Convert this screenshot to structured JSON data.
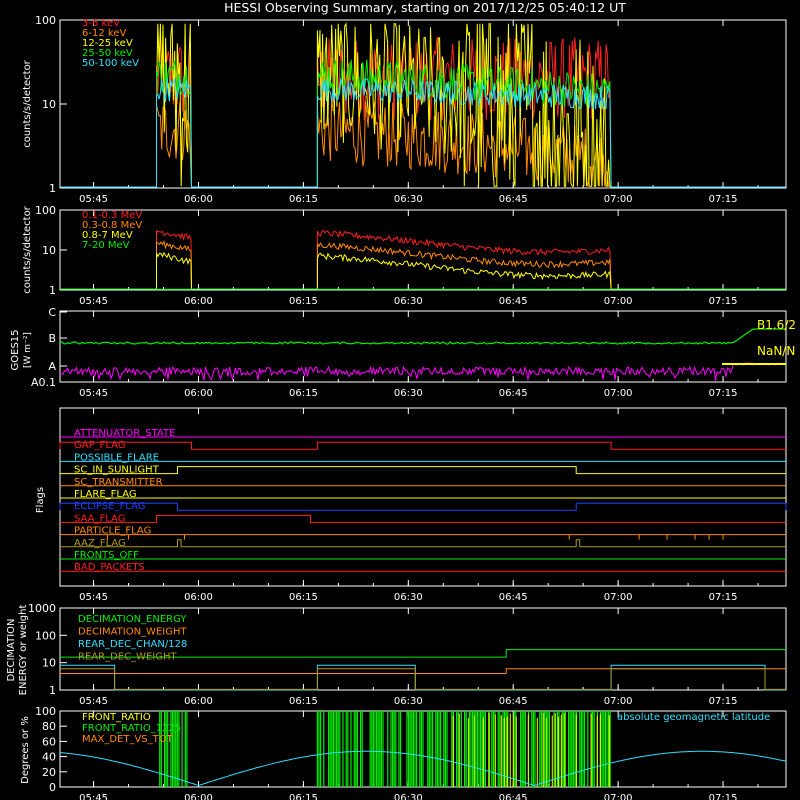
{
  "title": "HESSI Observing Summary, starting on 2017/12/25 05:40:12 UT",
  "time_axis": {
    "start": "05:40:12",
    "end": "07:24:00",
    "tick_labels": [
      "05:45",
      "06:00",
      "06:15",
      "06:30",
      "06:45",
      "07:00",
      "07:15"
    ]
  },
  "colors": {
    "red": "#ff2020",
    "orange": "#ff8a00",
    "yellow": "#ffff00",
    "green": "#00ee00",
    "cyan": "#30e0ff",
    "magenta": "#ff00ff",
    "blue": "#2040ff",
    "olive": "#b09a20",
    "white": "#ffffff",
    "bg": "#000000"
  },
  "chart_data": [
    {
      "type": "line",
      "panel": "low-energy count rates",
      "ylabel": "counts/s/detector",
      "yscale": "log",
      "ylim": [
        1,
        100
      ],
      "y_tick_labels": [
        "1",
        "10",
        "100"
      ],
      "data_intervals": [
        [
          "05:54",
          "05:59"
        ],
        [
          "06:17",
          "06:59"
        ]
      ],
      "series": [
        {
          "name": "3-6 keV",
          "color": "red",
          "values_at_start": 20,
          "values_at_end": 20
        },
        {
          "name": "6-12 keV",
          "color": "orange",
          "values_at_start": 5,
          "values_at_end": 2
        },
        {
          "name": "12-25 keV",
          "color": "yellow",
          "values_at_start": 22,
          "values_at_end": 1
        },
        {
          "name": "25-50 keV",
          "color": "green",
          "values_at_start": 22,
          "values_at_end": 14
        },
        {
          "name": "50-100 keV",
          "color": "cyan",
          "values_at_start": 15,
          "values_at_end": 12
        }
      ]
    },
    {
      "type": "line",
      "panel": "high-energy count rates",
      "ylabel": "counts/s/detector",
      "yscale": "log",
      "ylim": [
        1,
        100
      ],
      "y_tick_labels": [
        "1",
        "10",
        "100"
      ],
      "data_intervals": [
        [
          "05:54",
          "05:59"
        ],
        [
          "06:17",
          "06:59"
        ]
      ],
      "series": [
        {
          "name": "0.1-0.3 MeV",
          "color": "red",
          "values_at_start": 30,
          "values_at_end": 20
        },
        {
          "name": "0.3-0.8 MeV",
          "color": "orange",
          "values_at_start": 15,
          "values_at_end": 10
        },
        {
          "name": "0.8-7 MeV",
          "color": "yellow",
          "values_at_start": 8,
          "values_at_end": 5
        },
        {
          "name": "7-20 MeV",
          "color": "green",
          "values_at_start": 1,
          "values_at_end": 1
        }
      ]
    },
    {
      "type": "line",
      "panel": "GOES",
      "ylabel": "GOES15",
      "ylabel2": "[W m⁻²]",
      "y_tick_labels": [
        "A0.1",
        "A",
        "B",
        "C"
      ],
      "series": [
        {
          "name": "long",
          "color": "green",
          "level": "A6"
        },
        {
          "name": "short",
          "color": "magenta",
          "level": "A0.3"
        }
      ],
      "annotations": [
        "B1.6/2",
        "NaN/N"
      ]
    },
    {
      "type": "step",
      "panel": "Flags",
      "ylabel": "Flags",
      "flags": [
        {
          "name": "ATTENUATOR_STATE",
          "color": "magenta"
        },
        {
          "name": "GAP_FLAG",
          "color": "red"
        },
        {
          "name": "POSSIBLE_FLARE",
          "color": "cyan"
        },
        {
          "name": "SC_IN_SUNLIGHT",
          "color": "yellow"
        },
        {
          "name": "SC_TRANSMITTER",
          "color": "orange"
        },
        {
          "name": "FLARE_FLAG",
          "color": "yellow"
        },
        {
          "name": "ECLIPSE_FLAG",
          "color": "blue"
        },
        {
          "name": "SAA_FLAG",
          "color": "red"
        },
        {
          "name": "PARTICLE_FLAG",
          "color": "orange"
        },
        {
          "name": "AAZ_FLAG",
          "color": "olive"
        },
        {
          "name": "FRONTS_OFF",
          "color": "green"
        },
        {
          "name": "BAD_PACKETS",
          "color": "red"
        }
      ]
    },
    {
      "type": "step",
      "panel": "decimation",
      "ylabel": "DECIMATION",
      "ylabel2": "ENERGY or weight",
      "yscale": "log",
      "ylim": [
        1,
        1000
      ],
      "y_tick_labels": [
        "1",
        "10",
        "100",
        "1000"
      ],
      "series": [
        {
          "name": "DECIMATION_ENERGY",
          "color": "green"
        },
        {
          "name": "DECIMATION_WEIGHT",
          "color": "orange"
        },
        {
          "name": "REAR_DEC_CHAN/128",
          "color": "cyan"
        },
        {
          "name": "REAR_DEC_WEIGHT",
          "color": "olive"
        }
      ]
    },
    {
      "type": "line",
      "panel": "ratios and latitude",
      "ylabel": "Degrees or %",
      "ylim": [
        0,
        100
      ],
      "y_tick_labels": [
        "0",
        "20",
        "40",
        "60",
        "80",
        "100"
      ],
      "series": [
        {
          "name": "FRONT_RATIO",
          "color": "yellow"
        },
        {
          "name": "FRONT_RATIO_1225",
          "color": "green"
        },
        {
          "name": "MAX_DET_VS_TOT",
          "color": "orange"
        },
        {
          "name": "absolute geomagnetic latitude",
          "color": "cyan"
        }
      ]
    }
  ]
}
